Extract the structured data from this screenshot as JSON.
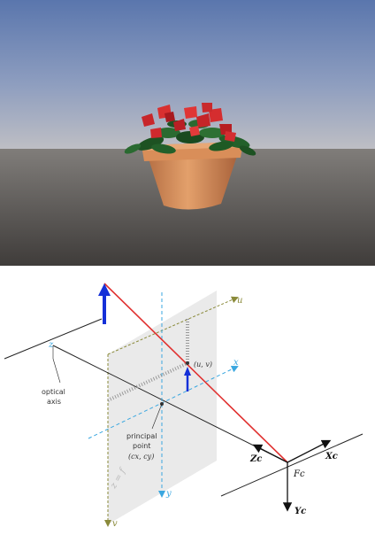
{
  "scene": {
    "colors": {
      "sky_top": "#5f7bb0",
      "sky_horizon": "#b9b9c0",
      "ground_near": "#4a4744",
      "ground_far": "#7a7774",
      "pot": "#d9935f",
      "pot_shade": "#b36f44",
      "leaf": "#1f5a24",
      "flower": "#d1272b"
    }
  },
  "diagram": {
    "labels": {
      "u_axis": "u",
      "v_axis": "v",
      "x_axis": "x",
      "y_axis": "y",
      "z_axis": "z",
      "optical_axis_line1": "optical",
      "optical_axis_line2": "axis",
      "principal_point_line1": "principal",
      "principal_point_line2": "point",
      "principal_point_coords": "(cx, cy)",
      "image_point": "(u, v)",
      "focal_plane": "z = f",
      "camera_center": "Fc",
      "camera_x": "Xc",
      "camera_y": "Yc",
      "camera_z": "Zc"
    },
    "colors": {
      "ray": "#e0302f",
      "object_arrow": "#1530d8",
      "image_axes": "#3aa7e0",
      "uv_axes": "#8a8a3a",
      "plane_fill": "#e6e6e6",
      "line": "#222222"
    }
  }
}
